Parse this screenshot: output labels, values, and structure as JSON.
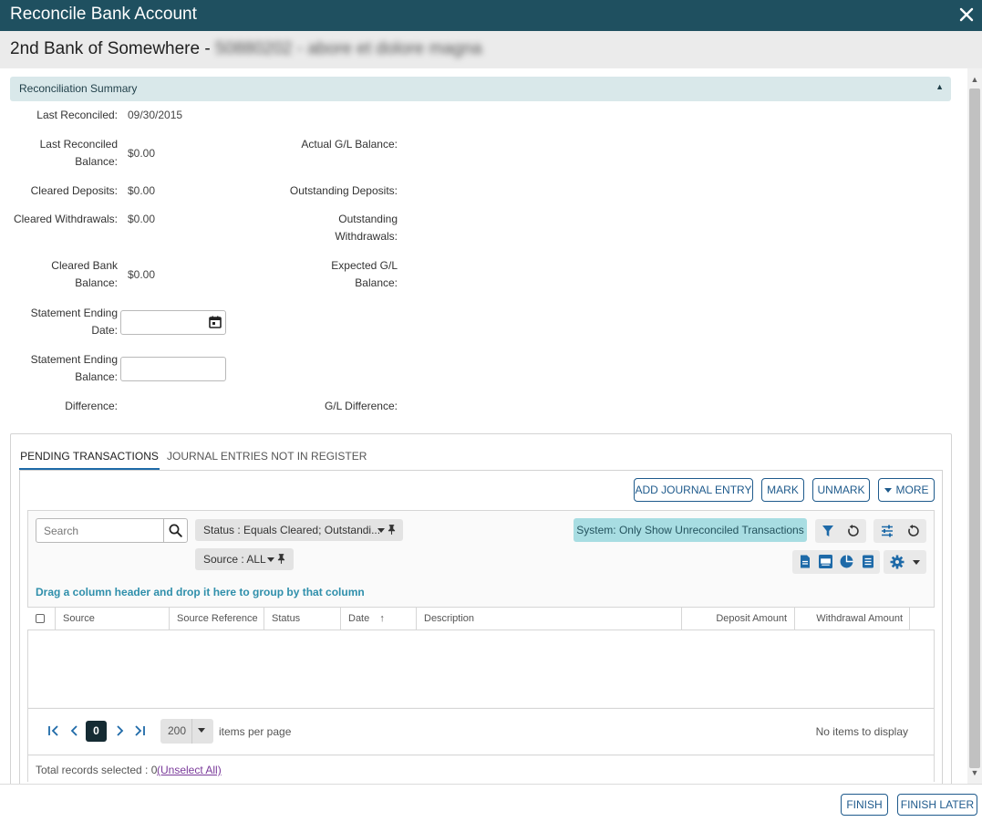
{
  "window": {
    "title": "Reconcile Bank Account"
  },
  "header": {
    "account_name": "2nd Bank of Somewhere - ",
    "account_redacted": "50880202 - abore et dolore magna"
  },
  "summary": {
    "section_title": "Reconciliation Summary",
    "last_reconciled_label": "Last Reconciled:",
    "last_reconciled_value": "09/30/2015",
    "last_reconciled_balance_label_1": "Last Reconciled",
    "last_reconciled_balance_label_2": "Balance:",
    "last_reconciled_balance_value": "$0.00",
    "actual_gl_balance_label": "Actual G/L Balance:",
    "cleared_deposits_label": "Cleared Deposits:",
    "cleared_deposits_value": "$0.00",
    "outstanding_deposits_label": "Outstanding Deposits:",
    "cleared_withdrawals_label": "Cleared Withdrawals:",
    "cleared_withdrawals_value": "$0.00",
    "outstanding_withdrawals_label_1": "Outstanding",
    "outstanding_withdrawals_label_2": "Withdrawals:",
    "cleared_bank_balance_label_1": "Cleared Bank",
    "cleared_bank_balance_label_2": "Balance:",
    "cleared_bank_balance_value": "$0.00",
    "expected_gl_balance_label_1": "Expected G/L",
    "expected_gl_balance_label_2": "Balance:",
    "statement_ending_date_label_1": "Statement Ending",
    "statement_ending_date_label_2": "Date:",
    "statement_ending_date_value": "",
    "statement_ending_balance_label_1": "Statement Ending",
    "statement_ending_balance_label_2": "Balance:",
    "statement_ending_balance_value": "",
    "difference_label": "Difference:",
    "gl_difference_label": "G/L Difference:"
  },
  "tabs": [
    {
      "label": "PENDING TRANSACTIONS",
      "active": true
    },
    {
      "label": "JOURNAL ENTRIES NOT IN REGISTER",
      "active": false
    }
  ],
  "actions": {
    "add_journal_entry": "ADD JOURNAL ENTRY",
    "mark": "MARK",
    "unmark": "UNMARK",
    "more": "MORE"
  },
  "grid": {
    "search_placeholder": "Search",
    "filter_status": "Status : Equals Cleared; Outstandi...",
    "filter_source": "Source : ALL",
    "system_filter": "System: Only Show Unreconciled Transactions",
    "group_hint": "Drag a column header and drop it here to group by that column",
    "columns": [
      "Source",
      "Source Reference",
      "Status",
      "Date",
      "Description",
      "Deposit Amount",
      "Withdrawal Amount"
    ],
    "sort_column": "Date",
    "sort_indicator": "↑",
    "current_page": "0",
    "page_size": "200",
    "items_per_page_label": "items per page",
    "no_items": "No items to display",
    "total_selected_label": "Total records selected : 0",
    "unselect_all": "(Unselect All)"
  },
  "footer": {
    "finish": "FINISH",
    "finish_later": "FINISH LATER"
  },
  "colors": {
    "titlebar": "#1f5060",
    "summary_bar": "#d9e8ea",
    "accent": "#1e6aa8",
    "system_pill": "#a8dde2",
    "link": "#2f8fab"
  }
}
